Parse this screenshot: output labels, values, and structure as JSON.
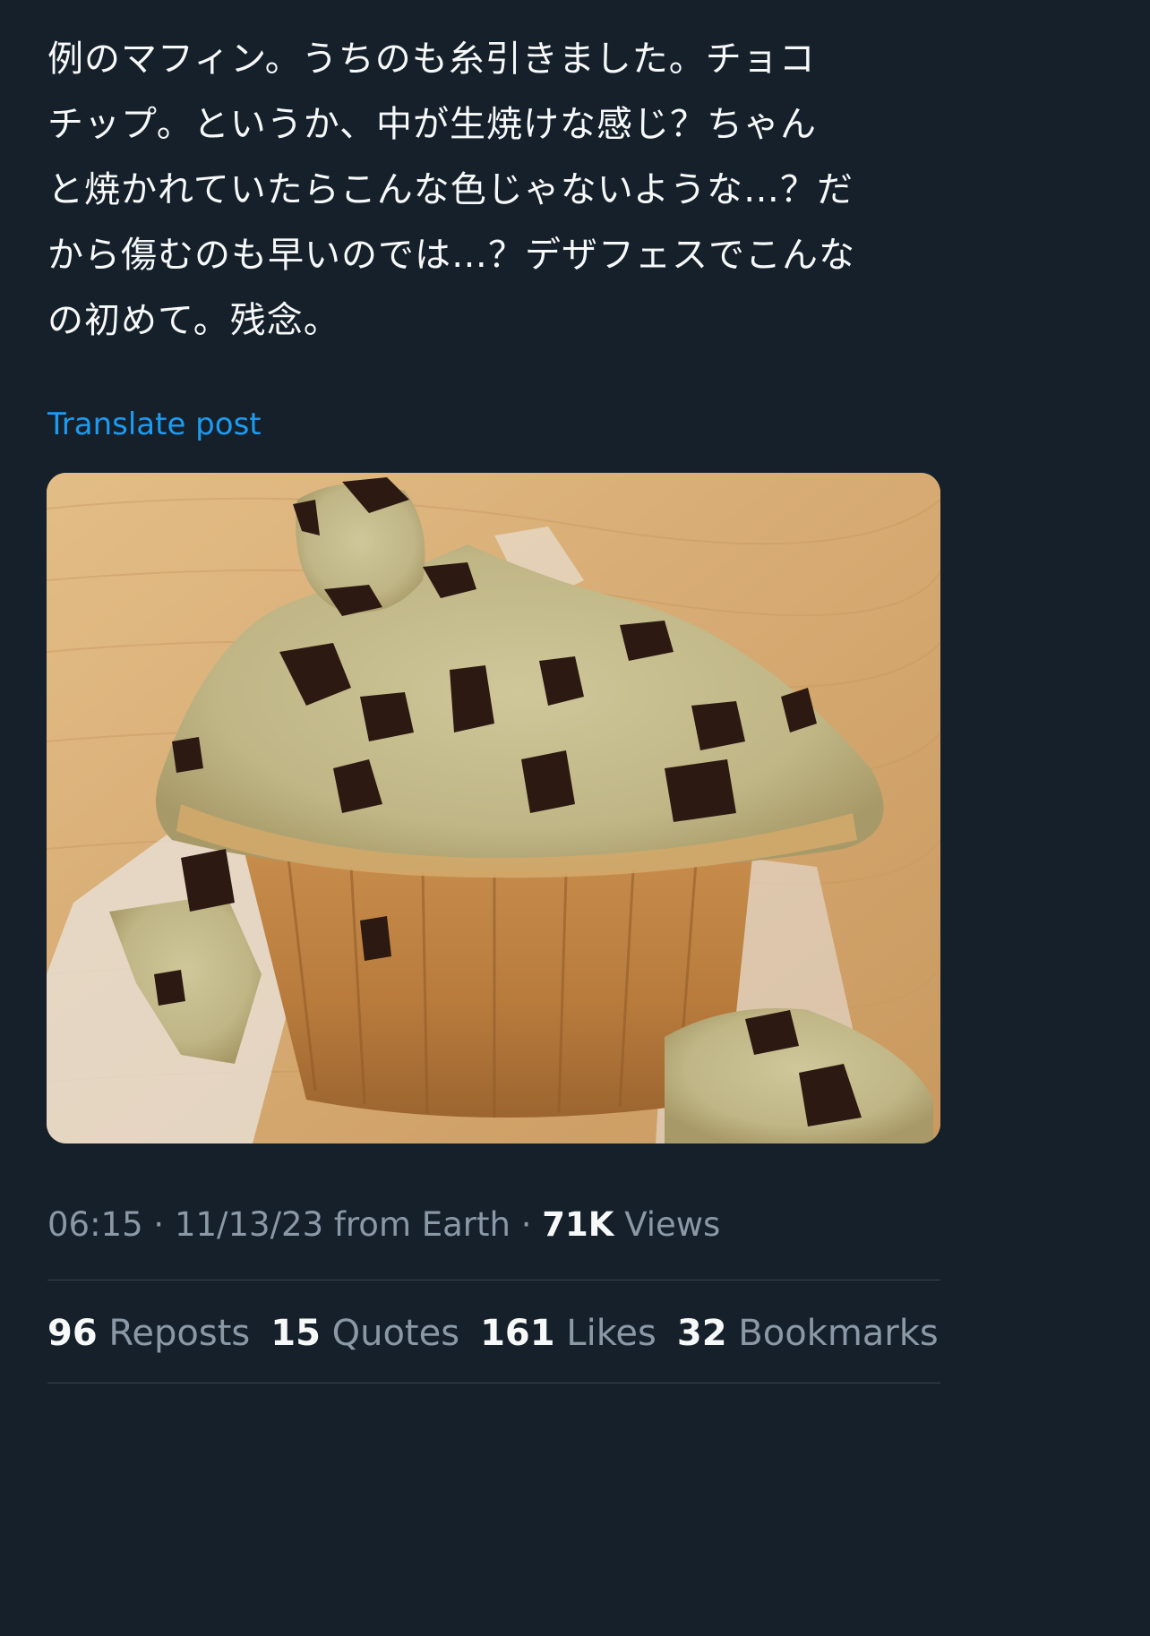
{
  "post": {
    "text": "例のマフィン。うちのも糸引きました。チョコ\nチップ。というか、中が生焼けな感じ？ちゃん\nと焼かれていたらこんな色じゃないような…？だ\nから傷むのも早いのでは…？デザフェスでこんな\nの初めて。残念。",
    "translate_label": "Translate post",
    "image_alt": "Broken chocolate chip muffin in a paper cup on a wooden table"
  },
  "meta": {
    "time": "06:15",
    "sep1": " · ",
    "date": "11/13/23",
    "source": " from Earth",
    "sep2": " · ",
    "views_count": "71K",
    "views_label": " Views"
  },
  "stats": [
    {
      "count": "96",
      "label": "Reposts"
    },
    {
      "count": "15",
      "label": "Quotes"
    },
    {
      "count": "161",
      "label": "Likes"
    },
    {
      "count": "32",
      "label": "Bookmarks"
    }
  ],
  "colors": {
    "background": "#15202b",
    "text": "#f7f9f9",
    "muted": "#8b98a5",
    "link": "#1d9bf0",
    "divider": "#38444d"
  }
}
